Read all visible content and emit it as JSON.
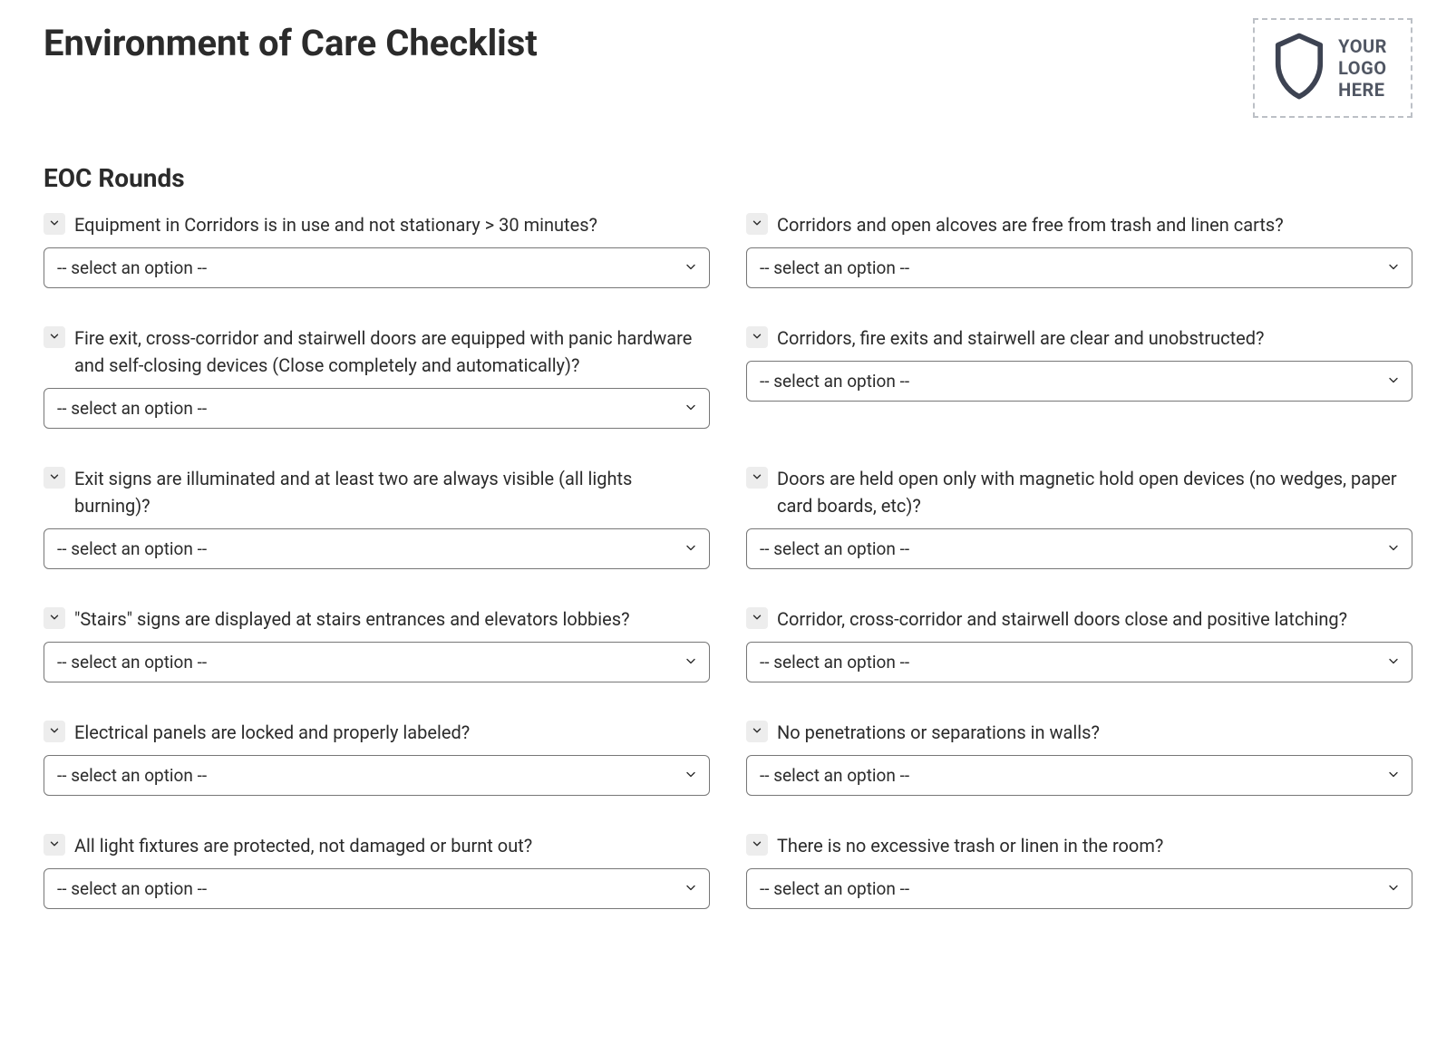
{
  "title": "Environment of Care Checklist",
  "logo": {
    "line1": "YOUR",
    "line2": "LOGO",
    "line3": "HERE"
  },
  "section_title": "EOC Rounds",
  "select_placeholder": "-- select an option --",
  "rows": [
    {
      "left": "Equipment in Corridors is in use and not stationary > 30 minutes?",
      "right": "Corridors and open alcoves are free from trash and linen carts?"
    },
    {
      "left": "Fire exit, cross-corridor and stairwell doors are equipped with panic hardware and self-closing devices (Close completely and automatically)?",
      "right": "Corridors, fire exits and stairwell are clear and unobstructed?"
    },
    {
      "left": "Exit signs are illuminated and at least two are always visible (all lights burning)?",
      "right": "Doors are held open only with magnetic hold open devices (no wedges, paper card boards, etc)?"
    },
    {
      "left": "\"Stairs\" signs are displayed at stairs entrances and elevators lobbies?",
      "right": "Corridor, cross-corridor and stairwell doors close and positive latching?"
    },
    {
      "left": "Electrical panels are locked and properly labeled?",
      "right": "No penetrations or separations in walls?"
    },
    {
      "left": "All light fixtures are protected, not damaged or burnt out?",
      "right": "There is no excessive trash or linen in the room?"
    }
  ]
}
